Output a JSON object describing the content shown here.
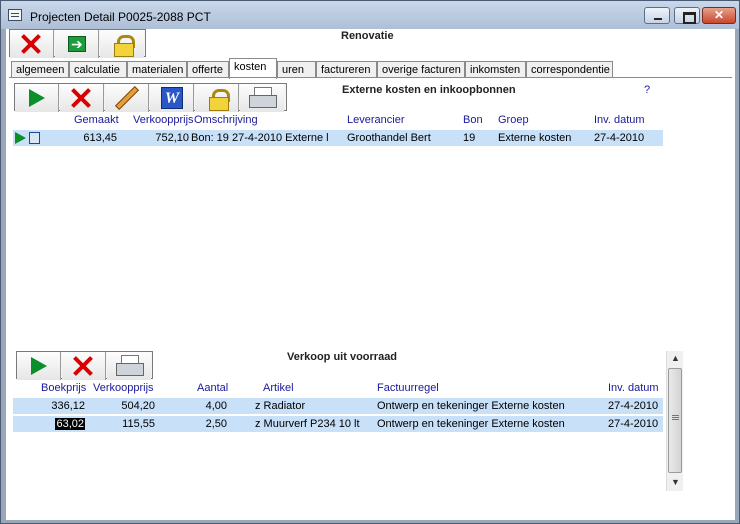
{
  "window": {
    "title": "Projecten Detail   P0025-2088   PCT",
    "close_glyph": "✕"
  },
  "header": {
    "project_name": "Renovatie"
  },
  "tabs": [
    "algemeen",
    "calculatie",
    "materialen",
    "offerte",
    "kosten",
    "uren",
    "factureren",
    "overige facturen",
    "inkomsten",
    "correspondentie"
  ],
  "active_tab": "kosten",
  "external": {
    "title": "Externe kosten en inkoopbonnen",
    "help": "?",
    "columns": [
      "Gemaakt",
      "Verkoopprijs",
      "Omschrijving",
      "Leverancier",
      "Bon",
      "Groep",
      "Inv. datum"
    ],
    "rows": [
      {
        "gemaakt": "613,45",
        "verkoopprijs": "752,10",
        "omschrijving": "Bon: 19 27-4-2010 Externe l",
        "leverancier": "Groothandel Bert",
        "bon": "19",
        "groep": "Externe kosten",
        "datum": "27-4-2010"
      }
    ]
  },
  "stock": {
    "title": "Verkoop uit voorraad",
    "columns": [
      "Boekprijs",
      "Verkoopprijs",
      "Aantal",
      "Artikel",
      "Factuurregel",
      "Inv. datum"
    ],
    "rows": [
      {
        "boekprijs": "336,12",
        "verkoopprijs": "504,20",
        "aantal": "4,00",
        "artikel": "z Radiator",
        "factuurregel": "Ontwerp en tekeninger Externe kosten",
        "datum": "27-4-2010"
      },
      {
        "boekprijs": "63,02",
        "verkoopprijs": "115,55",
        "aantal": "2,50",
        "artikel": "z Muurverf P234 10 lt",
        "factuurregel": "Ontwerp en tekeninger Externe kosten",
        "datum": "27-4-2010"
      }
    ]
  },
  "icons": [
    "close-x-icon",
    "next-arrow-icon",
    "lock-icon",
    "play-icon",
    "delete-icon",
    "edit-pencil-icon",
    "word-icon",
    "print-icon"
  ]
}
